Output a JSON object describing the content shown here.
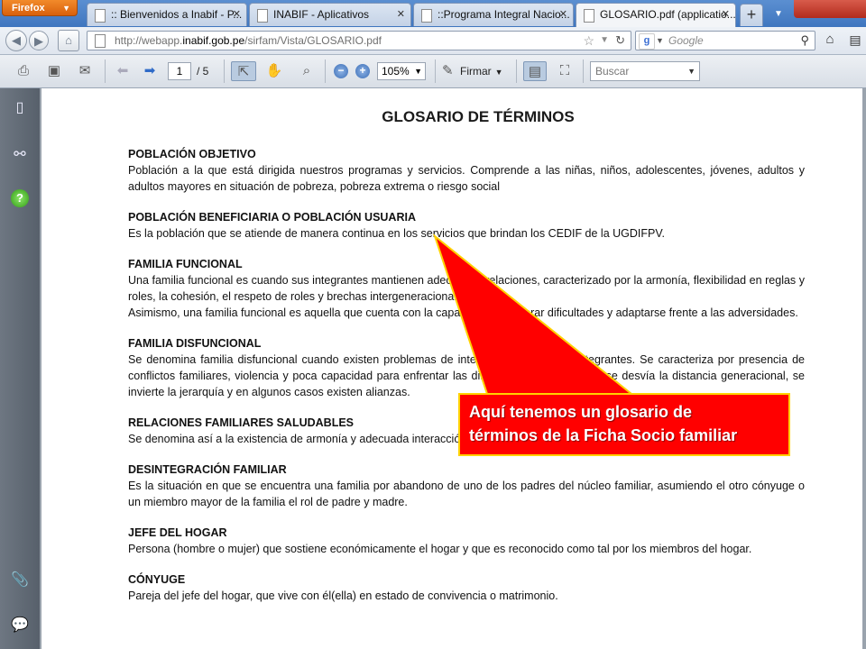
{
  "browser": {
    "menu_label": "Firefox",
    "tabs": [
      {
        "label": ":: Bienvenidos a Inabif - P...",
        "active": false
      },
      {
        "label": "INABIF - Aplicativos",
        "active": false
      },
      {
        "label": "::Programa Integral Nacio...",
        "active": false
      },
      {
        "label": "GLOSARIO.pdf (applicatio...",
        "active": true
      }
    ],
    "url_prefix": "http://webapp.",
    "url_domain": "inabif.gob.pe",
    "url_suffix": "/sirfam/Vista/GLOSARIO.pdf",
    "search_placeholder": "Google"
  },
  "pdf_toolbar": {
    "current_page": "1",
    "page_total": "/ 5",
    "zoom": "105%",
    "sign_label": "Firmar",
    "find_placeholder": "Buscar"
  },
  "document": {
    "title": "GLOSARIO DE TÉRMINOS",
    "sections": [
      {
        "heading": "POBLACIÓN OBJETIVO",
        "body": "Población a la que está dirigida nuestros programas y servicios. Comprende a las niñas, niños, adolescentes, jóvenes, adultos y adultos mayores en situación de pobreza, pobreza extrema o riesgo social"
      },
      {
        "heading": "POBLACIÓN BENEFICIARIA O POBLACIÓN USUARIA",
        "body": "Es la población que se atiende de manera continua en los servicios que brindan los CEDIF de la UGDIFPV."
      },
      {
        "heading": "FAMILIA FUNCIONAL",
        "body": "Una familia funcional es cuando sus integrantes mantienen adecuadas relaciones, caracterizado por la armonía, flexibilidad en reglas y roles, la cohesión, el respeto de roles y brechas intergeneracionales.",
        "body2": "Asimismo, una familia funcional es aquella que cuenta con la capacidad de superar dificultades y adaptarse frente a las adversidades."
      },
      {
        "heading": "FAMILIA  DISFUNCIONAL",
        "body": "Se denomina familia disfuncional cuando existen problemas de interrelación entre sus integrantes. Se caracteriza por presencia de conflictos familiares, violencia y poca capacidad para enfrentar las dificultades, se acentúa o se desvía la distancia generacional, se invierte la jerarquía y en algunos casos existen alianzas."
      },
      {
        "heading": "RELACIONES FAMILIARES SALUDABLES",
        "body": "Se denomina así a la existencia de armonía y adecuada interacción entre los integrantes de una familia."
      },
      {
        "heading": "DESINTEGRACIÓN FAMILIAR",
        "body": "Es la situación en que se encuentra una familia por abandono de uno de los padres del núcleo familiar, asumiendo el otro cónyuge o un miembro mayor de la familia el rol de padre y madre."
      },
      {
        "heading": "JEFE DEL HOGAR",
        "body": "Persona (hombre o mujer) que sostiene económicamente el hogar y que es reconocido como tal por los miembros del hogar."
      },
      {
        "heading": "CÓNYUGE",
        "body": "Pareja del jefe del hogar, que vive con él(ella) en estado de convivencia o matrimonio."
      }
    ]
  },
  "callout": {
    "line1": "Aquí tenemos un glosario de",
    "line2": "términos de la Ficha Socio familiar",
    "color": "#ff0000",
    "border_color": "#ffd200"
  }
}
